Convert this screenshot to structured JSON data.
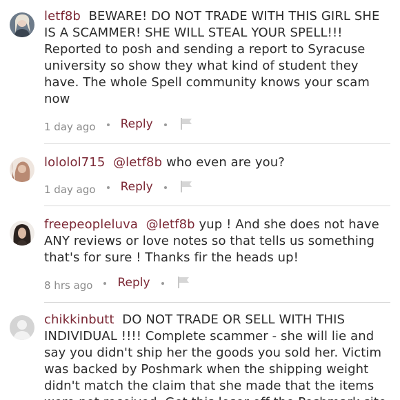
{
  "comments": [
    {
      "username": "letf8b",
      "mention": "",
      "body": "BEWARE! DO NOT TRADE WITH THIS GIRL SHE IS A SCAMMER! SHE WILL STEAL YOUR SPELL!!! Reported to posh and sending a report to Syracuse university so show they what kind of student they have. The whole Spell community knows your scam now",
      "time": "1 day ago",
      "reply_label": "Reply",
      "avatar_icon": "user-photo-avatar"
    },
    {
      "username": "lololol715",
      "mention": "@letf8b",
      "body": "who even are you?",
      "time": "1 day ago",
      "reply_label": "Reply",
      "avatar_icon": "user-photo-avatar"
    },
    {
      "username": "freepeopleluva",
      "mention": "@letf8b",
      "body": "yup ! And she does not have ANY reviews or love notes so that tells us something that's for sure ! Thanks fir the heads up!",
      "time": "8 hrs ago",
      "reply_label": "Reply",
      "avatar_icon": "user-photo-avatar"
    },
    {
      "username": "chikkinbutt",
      "mention": "",
      "body": "DO NOT TRADE OR SELL WITH THIS INDIVIDUAL !!!! Complete scammer - she will lie and say you didn't ship her the goods you sold her. Victim was backed by Poshmark when the shipping weight didn't match the claim that she made that the items were not received. Get this loser off the Poshmark site",
      "time": "",
      "reply_label": "",
      "avatar_icon": "default-user-avatar"
    }
  ],
  "colors": {
    "username": "#7b2734",
    "text": "#2b2b2b",
    "meta": "#8a8a8a",
    "divider": "#d9d9d9"
  }
}
